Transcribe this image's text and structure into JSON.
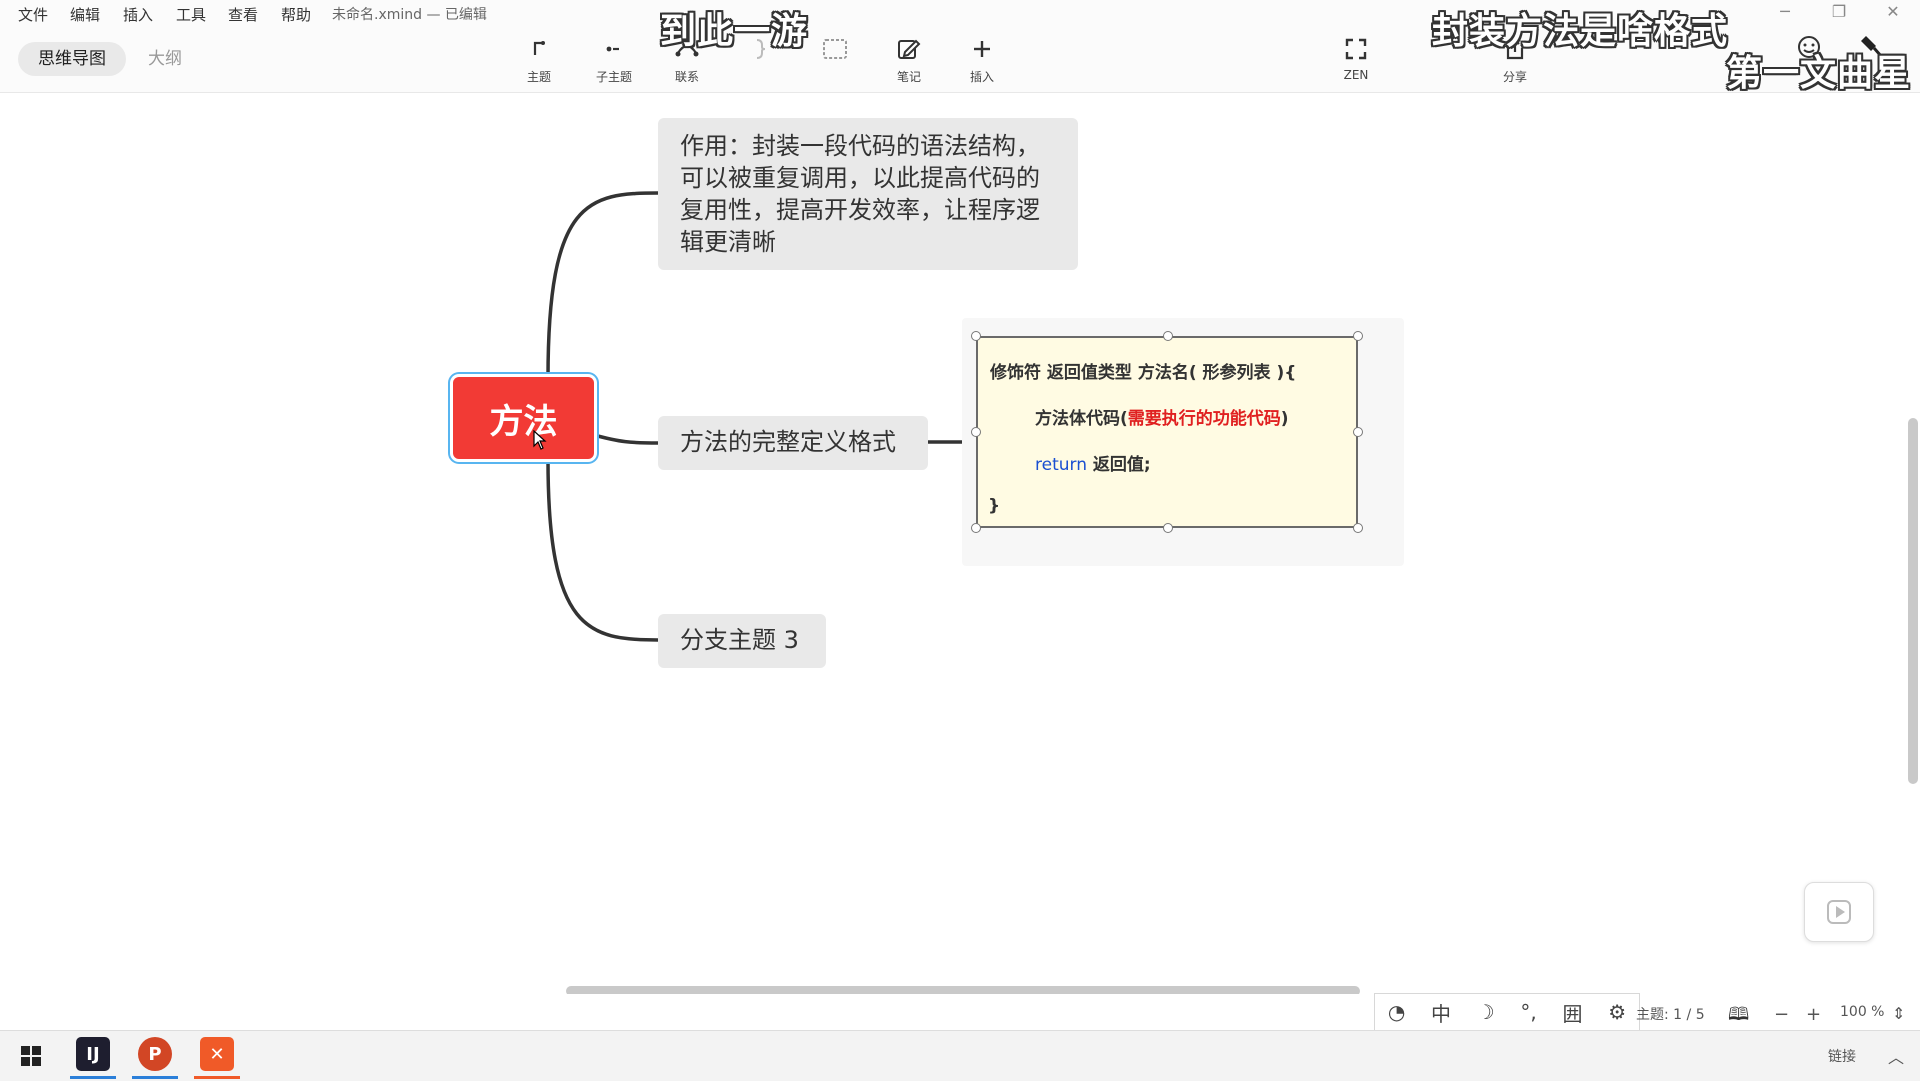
{
  "menubar": {
    "items": [
      "文件",
      "编辑",
      "插入",
      "工具",
      "查看",
      "帮助"
    ],
    "filename": "未命名.xmind — 已编辑"
  },
  "view_tabs": {
    "mindmap": "思维导图",
    "outline": "大纲"
  },
  "toolbar": {
    "topic": "主题",
    "subtopic": "子主题",
    "relationship": "联系",
    "note": "笔记",
    "insert": "插入",
    "zen": "ZEN",
    "share": "分享"
  },
  "captions": {
    "top_left": "到此一游",
    "top_right": "封装方法是啥格式",
    "top_right_2": "第一文曲星",
    "caption_color": "#ffffff",
    "outline_color": "#333333"
  },
  "mindmap": {
    "central_topic": "方法",
    "central_color": "#f23a35",
    "branch_1": "作用：封装一段代码的语法结构，可以被重复调用，以此提高代码的复用性，提高开发效率，让程序逻辑更清晰",
    "branch_2": "方法的完整定义格式",
    "branch_3": "分支主题 3",
    "note_card": {
      "line1": "修饰符  返回值类型  方法名( 形参列表 ){",
      "line2_prefix": "方法体代码(",
      "line2_red": "需要执行的功能代码",
      "line2_suffix": ")",
      "line3_keyword": "return",
      "line3_rest": " 返回值;",
      "line4": "}",
      "highlight_red": "#e02020",
      "keyword_blue": "#1a4fd1"
    }
  },
  "statusbar": {
    "ime_chinese": "中",
    "ime_table": "囲",
    "topic_count": "主题: 1 / 5",
    "zoom": "100 %",
    "zoom_out": "−",
    "zoom_in": "+"
  },
  "taskbar": {
    "link": "链接"
  }
}
